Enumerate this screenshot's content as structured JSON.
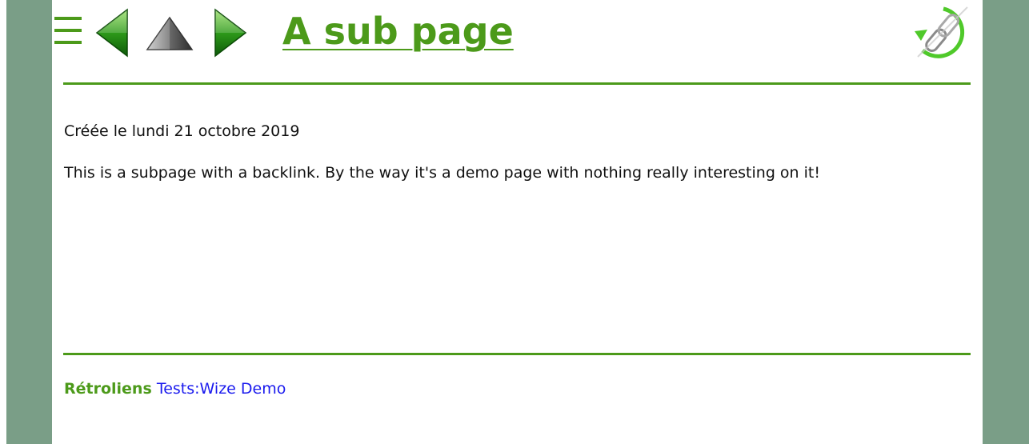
{
  "header": {
    "title": "A sub page",
    "menu_icon": "hamburger-menu-icon",
    "prev_icon": "green-left-arrow-icon",
    "up_icon": "gray-up-arrow-icon",
    "next_icon": "green-right-arrow-icon",
    "logo_icon": "backlink-chain-logo-icon"
  },
  "content": {
    "created": "Créée le lundi 21 octobre 2019",
    "body": "This is a subpage with a backlink. By the way it's a demo page with nothing really interesting on it!"
  },
  "footer": {
    "backlinks_label": "Rétroliens",
    "backlinks": [
      "Tests:Wize Demo"
    ]
  },
  "colors": {
    "accent": "#4c9a1a",
    "side_panel": "#7a9e87",
    "link": "#1a1aee"
  }
}
